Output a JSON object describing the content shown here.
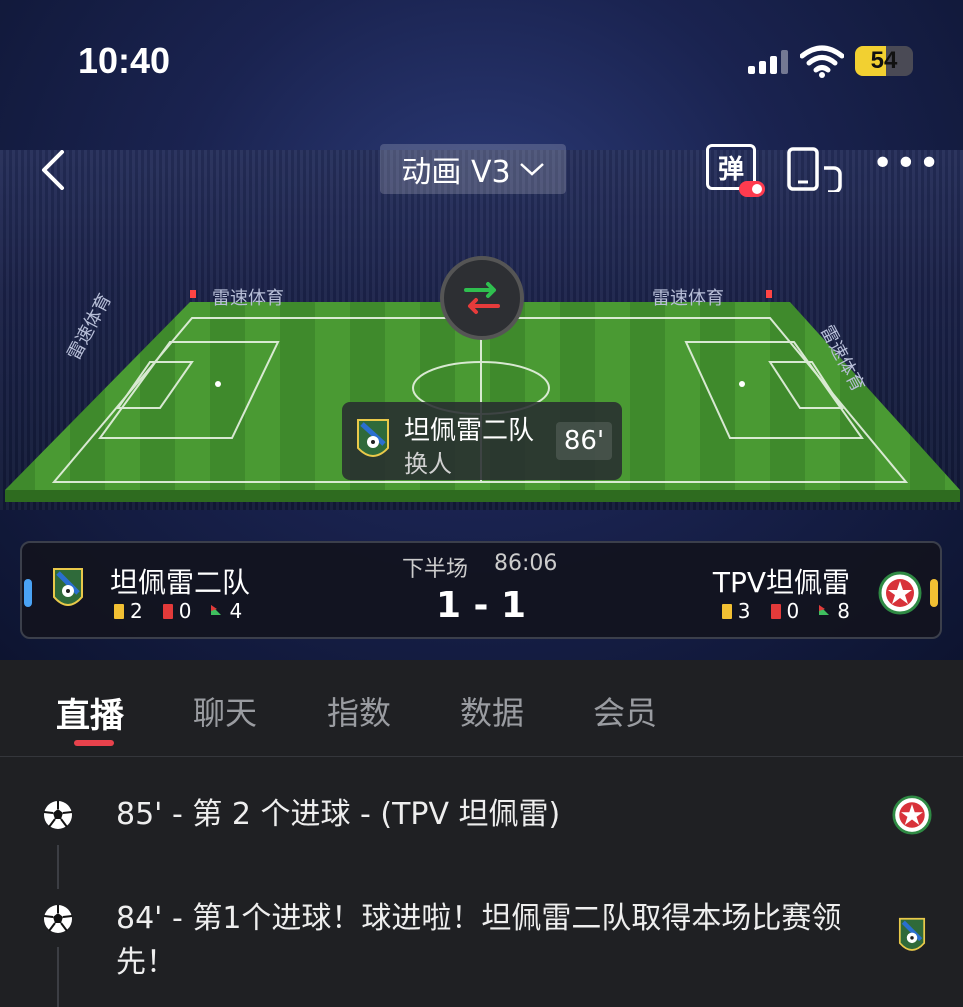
{
  "status": {
    "time": "10:40",
    "battery": "54",
    "battery_pct": 54
  },
  "nav": {
    "mode": "动画 V3",
    "danmu": "弹"
  },
  "banners": [
    "雷速体育",
    "雷速体育",
    "雷速体育",
    "雷速体育"
  ],
  "event": {
    "team": "坦佩雷二队",
    "type": "换人",
    "minute": "86'"
  },
  "match": {
    "period": "下半场",
    "clock": "86:06",
    "score": "1 - 1",
    "home": {
      "name": "坦佩雷二队",
      "yellow": "2",
      "red": "0",
      "corners": "4"
    },
    "away": {
      "name": "TPV坦佩雷",
      "yellow": "3",
      "red": "0",
      "corners": "8"
    }
  },
  "tabs": [
    "直播",
    "聊天",
    "指数",
    "数据",
    "会员"
  ],
  "feed": [
    {
      "text": "85' - 第 2 个进球 - (TPV 坦佩雷)",
      "team": "away"
    },
    {
      "text": "84' - 第1个进球！球进啦！坦佩雷二队取得本场比赛领先！",
      "team": "home"
    }
  ],
  "colors": {
    "accent": "#e8424c",
    "home": "#4aa3f5",
    "away": "#f2c033",
    "pitch": "#3f8a2c"
  }
}
